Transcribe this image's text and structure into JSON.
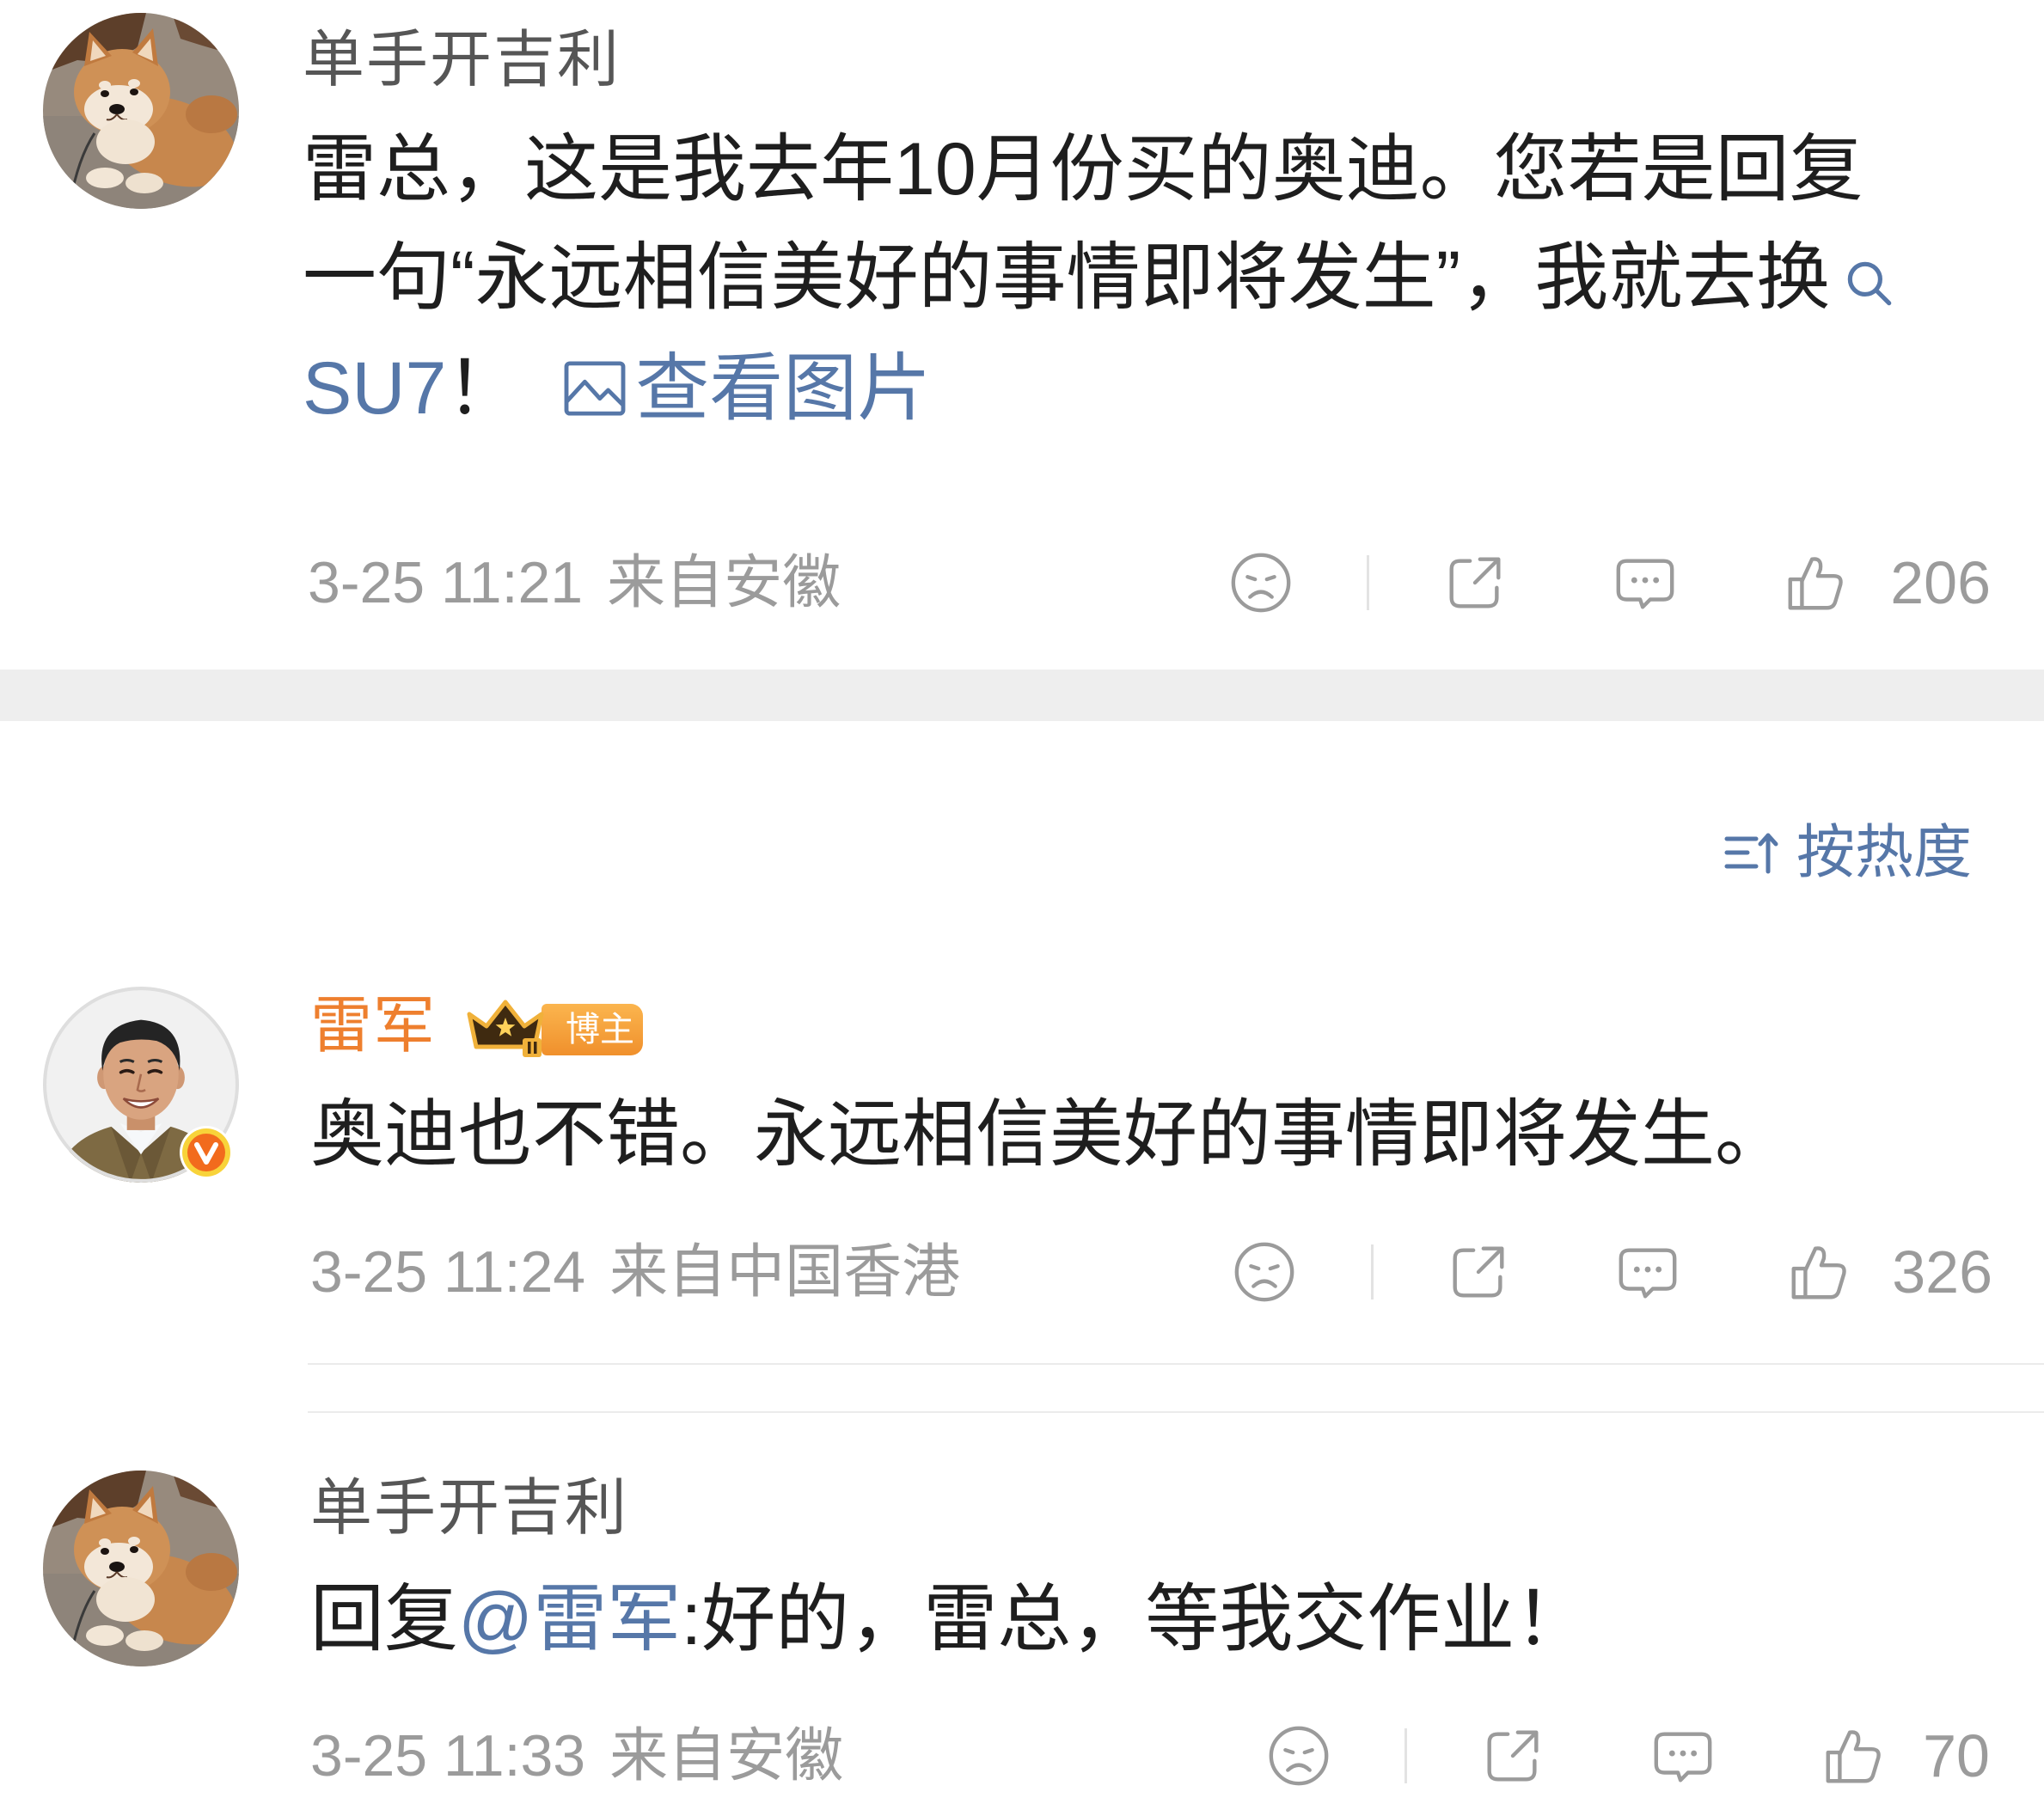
{
  "colors": {
    "text": "#1e1e1e",
    "username": "#565656",
    "meta": "#9b9b9b",
    "link": "#5677a8",
    "vip_name": "#ee7f2e",
    "badge": "#f0902c",
    "band": "#eeeeee",
    "icon": "#9b9b9b",
    "rule": "#ebebeb"
  },
  "icons": {
    "dislike": "dislike-face-icon",
    "share": "share-icon",
    "comment": "comment-icon",
    "like": "thumbs-up-icon",
    "search": "search-icon",
    "image": "image-icon",
    "sort": "sort-icon",
    "verified": "verified-v-icon",
    "crown": "crown-level-icon"
  },
  "sort": {
    "label": "按热度"
  },
  "comments": [
    {
      "username": "单手开吉利",
      "text_line_1": "雷总，这是我去年10月份买的奥迪。您若是回复",
      "text_line_2": "一句“永远相信美好的事情即将发生”，我就去换",
      "keyword": "SU7",
      "text_end": "！",
      "view_image_label": "查看图片",
      "time": "3-25 11:21",
      "location": "来自安徽",
      "likes": "206"
    },
    {
      "username": "雷军",
      "badge_label": "博主",
      "text": "奥迪也不错。永远相信美好的事情即将发生。",
      "time": "3-25 11:24",
      "location": "来自中国香港",
      "likes": "326"
    },
    {
      "username": "单手开吉利",
      "reply_prefix": "回复",
      "mention": "@雷军",
      "text": ":好的，雷总，等我交作业！",
      "time": "3-25 11:33",
      "location": "来自安徽",
      "likes": "70"
    }
  ]
}
